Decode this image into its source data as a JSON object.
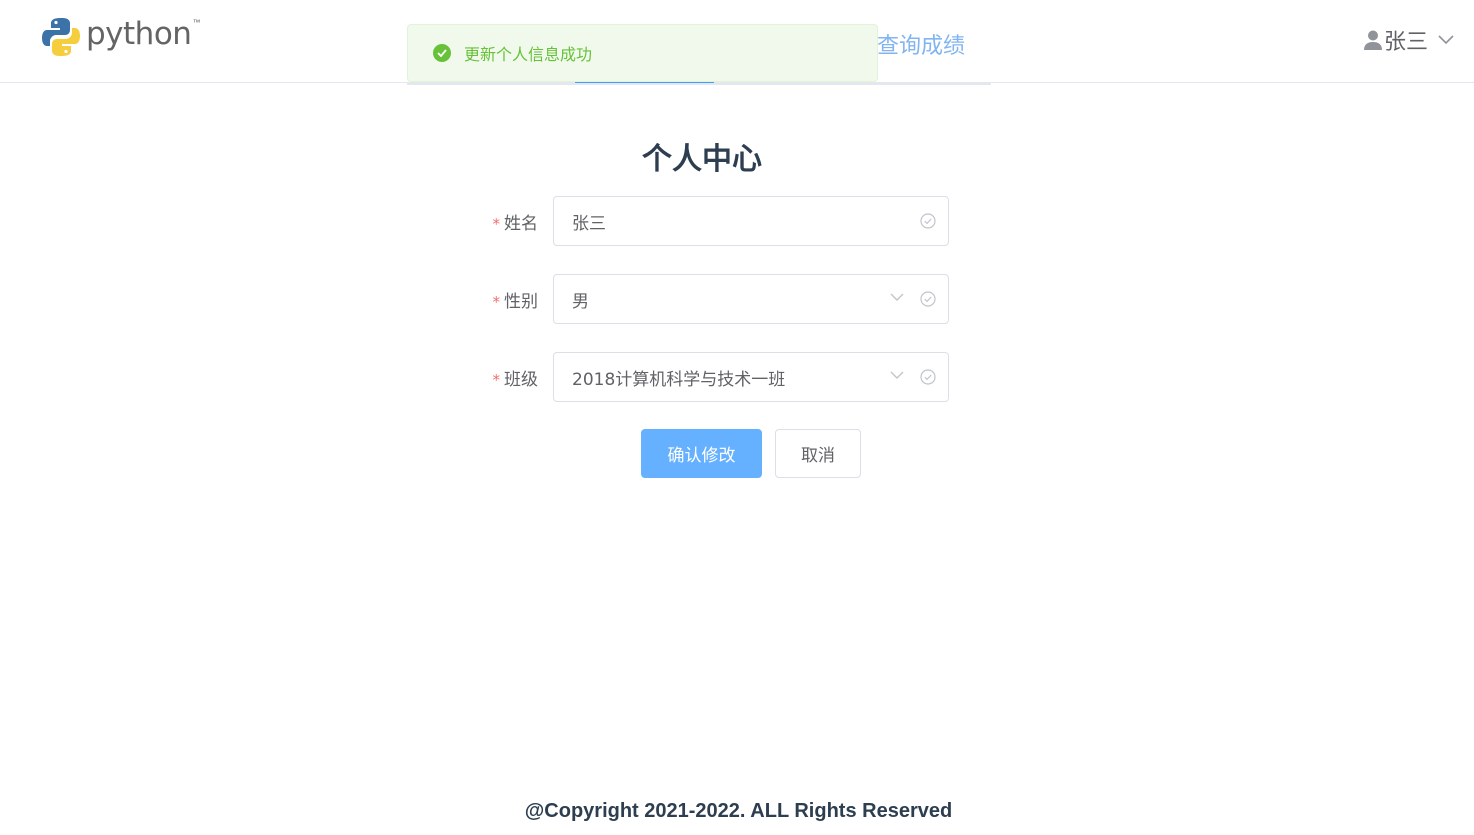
{
  "header": {
    "logo_text": "python",
    "logo_tm": "™",
    "nav_tab_label": "查询成绩",
    "user_name": "张三"
  },
  "toast": {
    "message": "更新个人信息成功"
  },
  "page": {
    "title": "个人中心"
  },
  "form": {
    "name": {
      "label": "姓名",
      "value": "张三"
    },
    "gender": {
      "label": "性别",
      "value": "男"
    },
    "class": {
      "label": "班级",
      "value": "2018计算机科学与技术一班"
    },
    "required_mark": "*"
  },
  "buttons": {
    "confirm_label": "确认修改",
    "cancel_label": "取消"
  },
  "footer": {
    "copyright": "@Copyright 2021-2022. ALL Rights Reserved"
  },
  "colors": {
    "primary": "#409eff",
    "primary_light": "#66b1ff",
    "success": "#67c23a",
    "danger": "#f56c6c"
  }
}
